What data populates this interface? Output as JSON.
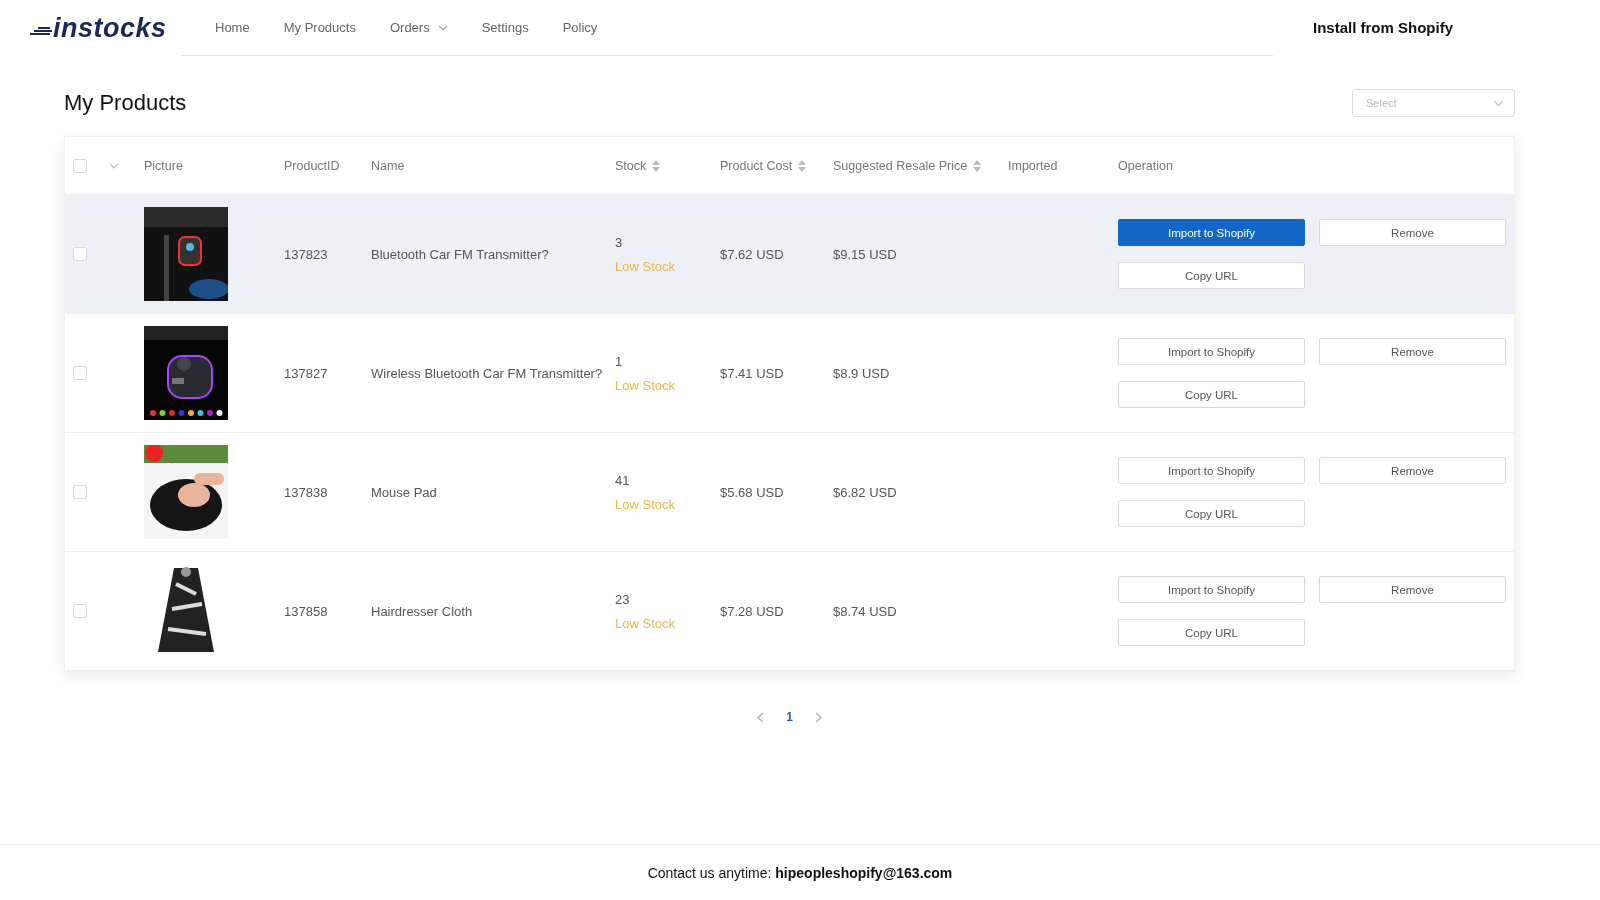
{
  "logo": "instocks",
  "nav": [
    {
      "label": "Home",
      "dropdown": false
    },
    {
      "label": "My Products",
      "dropdown": false
    },
    {
      "label": "Orders",
      "dropdown": true
    },
    {
      "label": "Settings",
      "dropdown": false
    },
    {
      "label": "Policy",
      "dropdown": false
    }
  ],
  "install_link": "Install from Shopify",
  "page_title": "My Products",
  "filter_select": {
    "placeholder": "Select"
  },
  "table": {
    "select_all": {
      "checked": false
    },
    "columns": [
      {
        "label": "Picture",
        "sortable": false
      },
      {
        "label": "ProductID",
        "sortable": false
      },
      {
        "label": "Name",
        "sortable": false
      },
      {
        "label": "Stock",
        "sortable": true
      },
      {
        "label": "Product Cost",
        "sortable": true
      },
      {
        "label": "Suggested Resale Price",
        "sortable": true
      },
      {
        "label": "Imported",
        "sortable": false
      },
      {
        "label": "Operation",
        "sortable": false
      }
    ],
    "rows": [
      {
        "checked": false,
        "highlighted": true,
        "product_id": "137823",
        "name": "Bluetooth Car FM Transmitter?",
        "stock": "3",
        "stock_status": "Low Stock",
        "cost": "$7.62 USD",
        "resale": "$9.15 USD",
        "import_button": {
          "label": "Import to Shopify",
          "primary": true
        },
        "remove_button": "Remove",
        "copy_button": "Copy URL"
      },
      {
        "checked": false,
        "highlighted": false,
        "product_id": "137827",
        "name": "Wireless Bluetooth Car FM Transmitter?",
        "stock": "1",
        "stock_status": "Low Stock",
        "cost": "$7.41 USD",
        "resale": "$8.9 USD",
        "import_button": {
          "label": "Import to Shopify",
          "primary": false
        },
        "remove_button": "Remove",
        "copy_button": "Copy URL"
      },
      {
        "checked": false,
        "highlighted": false,
        "product_id": "137838",
        "name": "Mouse Pad",
        "stock": "41",
        "stock_status": "Low Stock",
        "cost": "$5.68 USD",
        "resale": "$6.82 USD",
        "import_button": {
          "label": "Import to Shopify",
          "primary": false
        },
        "remove_button": "Remove",
        "copy_button": "Copy URL"
      },
      {
        "checked": false,
        "highlighted": false,
        "product_id": "137858",
        "name": "Hairdresser Cloth",
        "stock": "23",
        "stock_status": "Low Stock",
        "cost": "$7.28 USD",
        "resale": "$8.74 USD",
        "import_button": {
          "label": "Import to Shopify",
          "primary": false
        },
        "remove_button": "Remove",
        "copy_button": "Copy URL"
      }
    ]
  },
  "pagination": {
    "pages": [
      {
        "label": "1",
        "selected": true
      }
    ]
  },
  "footer": "Contact us anytime: **hipeopleshopify@163.com**"
}
